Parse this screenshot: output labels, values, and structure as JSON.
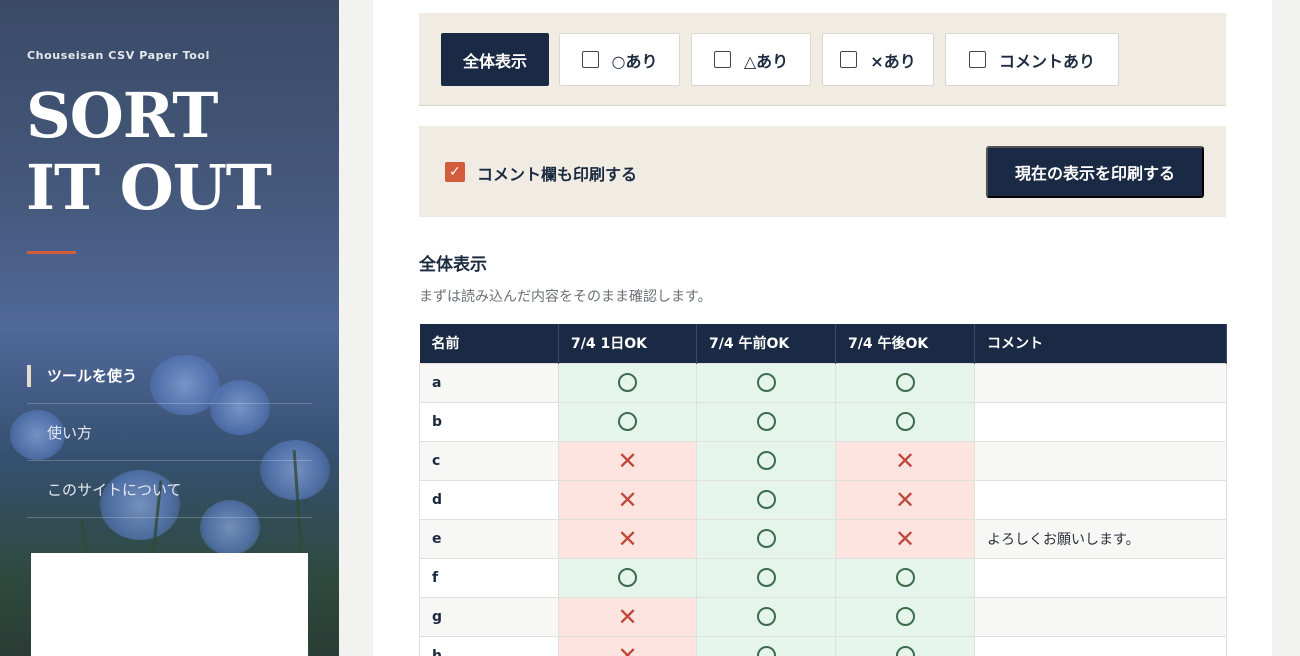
{
  "sidebar": {
    "subtitle": "Chouseisan CSV Paper Tool",
    "title_line1": "SORT",
    "title_line2": "IT OUT",
    "nav": [
      {
        "label": "ツールを使う"
      },
      {
        "label": "使い方"
      },
      {
        "label": "このサイトについて"
      }
    ]
  },
  "filters": {
    "all": "全体表示",
    "ok": "○あり",
    "maybe": "△あり",
    "ng": "×あり",
    "comment": "コメントあり"
  },
  "print": {
    "checkbox_label": "コメント欄も印刷する",
    "checked": true,
    "button": "現在の表示を印刷する"
  },
  "section": {
    "title": "全体表示",
    "description": "まずは読み込んだ内容をそのまま確認します。"
  },
  "table": {
    "headers": [
      "名前",
      "7/4 1日OK",
      "7/4 午前OK",
      "7/4 午後OK",
      "コメント"
    ],
    "rows": [
      {
        "name": "a",
        "marks": [
          "ok",
          "ok",
          "ok"
        ],
        "comment": ""
      },
      {
        "name": "b",
        "marks": [
          "ok",
          "ok",
          "ok"
        ],
        "comment": ""
      },
      {
        "name": "c",
        "marks": [
          "ng",
          "ok",
          "ng"
        ],
        "comment": ""
      },
      {
        "name": "d",
        "marks": [
          "ng",
          "ok",
          "ng"
        ],
        "comment": ""
      },
      {
        "name": "e",
        "marks": [
          "ng",
          "ok",
          "ng"
        ],
        "comment": "よろしくお願いします。"
      },
      {
        "name": "f",
        "marks": [
          "ok",
          "ok",
          "ok"
        ],
        "comment": ""
      },
      {
        "name": "g",
        "marks": [
          "ng",
          "ok",
          "ok"
        ],
        "comment": ""
      },
      {
        "name": "h",
        "marks": [
          "ng",
          "ok",
          "ok"
        ],
        "comment": ""
      }
    ]
  },
  "colors": {
    "navy": "#1b2a44",
    "accent": "#d25c3c",
    "ok_bg": "#e6f5eb",
    "ng_bg": "#fde4e0"
  }
}
